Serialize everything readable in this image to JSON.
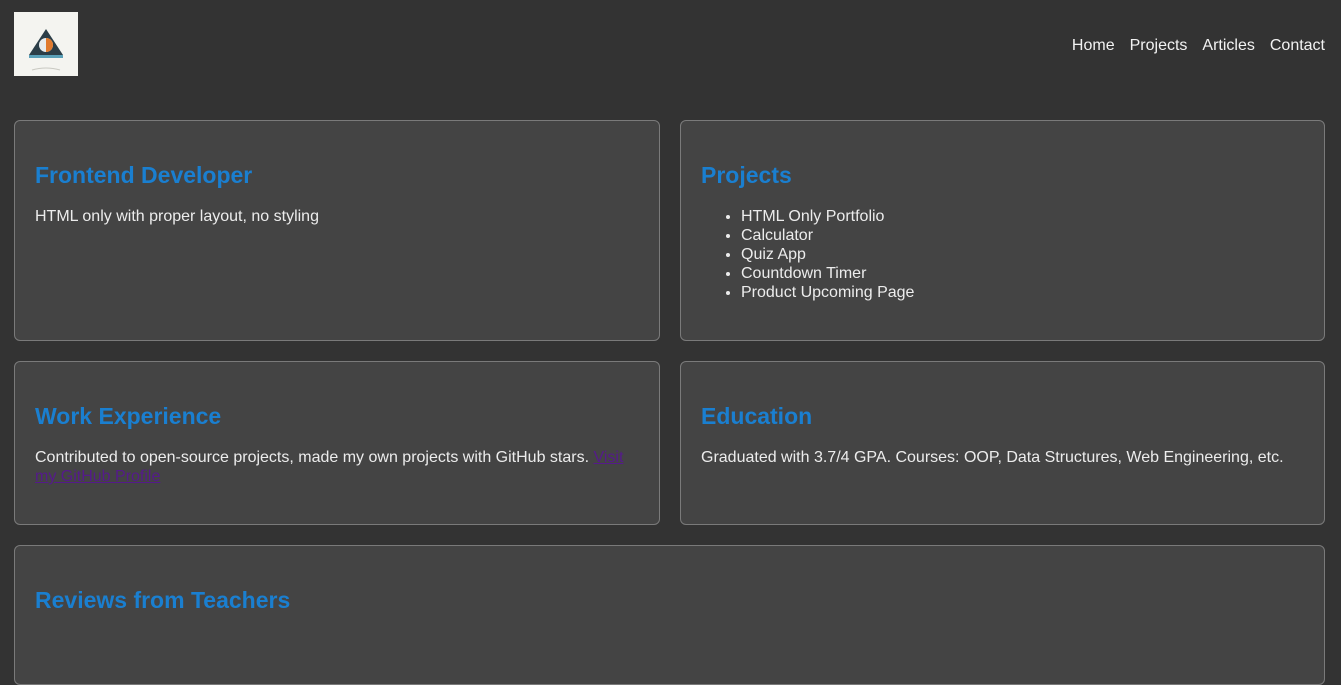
{
  "nav": {
    "items": [
      "Home",
      "Projects",
      "Articles",
      "Contact"
    ]
  },
  "cards": {
    "frontend": {
      "title": "Frontend Developer",
      "text": "HTML only with proper layout, no styling"
    },
    "projects": {
      "title": "Projects",
      "items": [
        "HTML Only Portfolio",
        "Calculator",
        "Quiz App",
        "Countdown Timer",
        "Product Upcoming Page"
      ]
    },
    "work": {
      "title": "Work Experience",
      "text": "Contributed to open-source projects, made my own projects with GitHub stars. ",
      "link": "Visit my GitHub Profile"
    },
    "education": {
      "title": "Education",
      "text": "Graduated with 3.7/4 GPA. Courses: OOP, Data Structures, Web Engineering, etc."
    },
    "reviews": {
      "title": "Reviews from Teachers"
    }
  },
  "colors": {
    "background": "#333333",
    "card": "#444444",
    "heading": "#1a7fd0",
    "visited_link": "#551a8b"
  }
}
